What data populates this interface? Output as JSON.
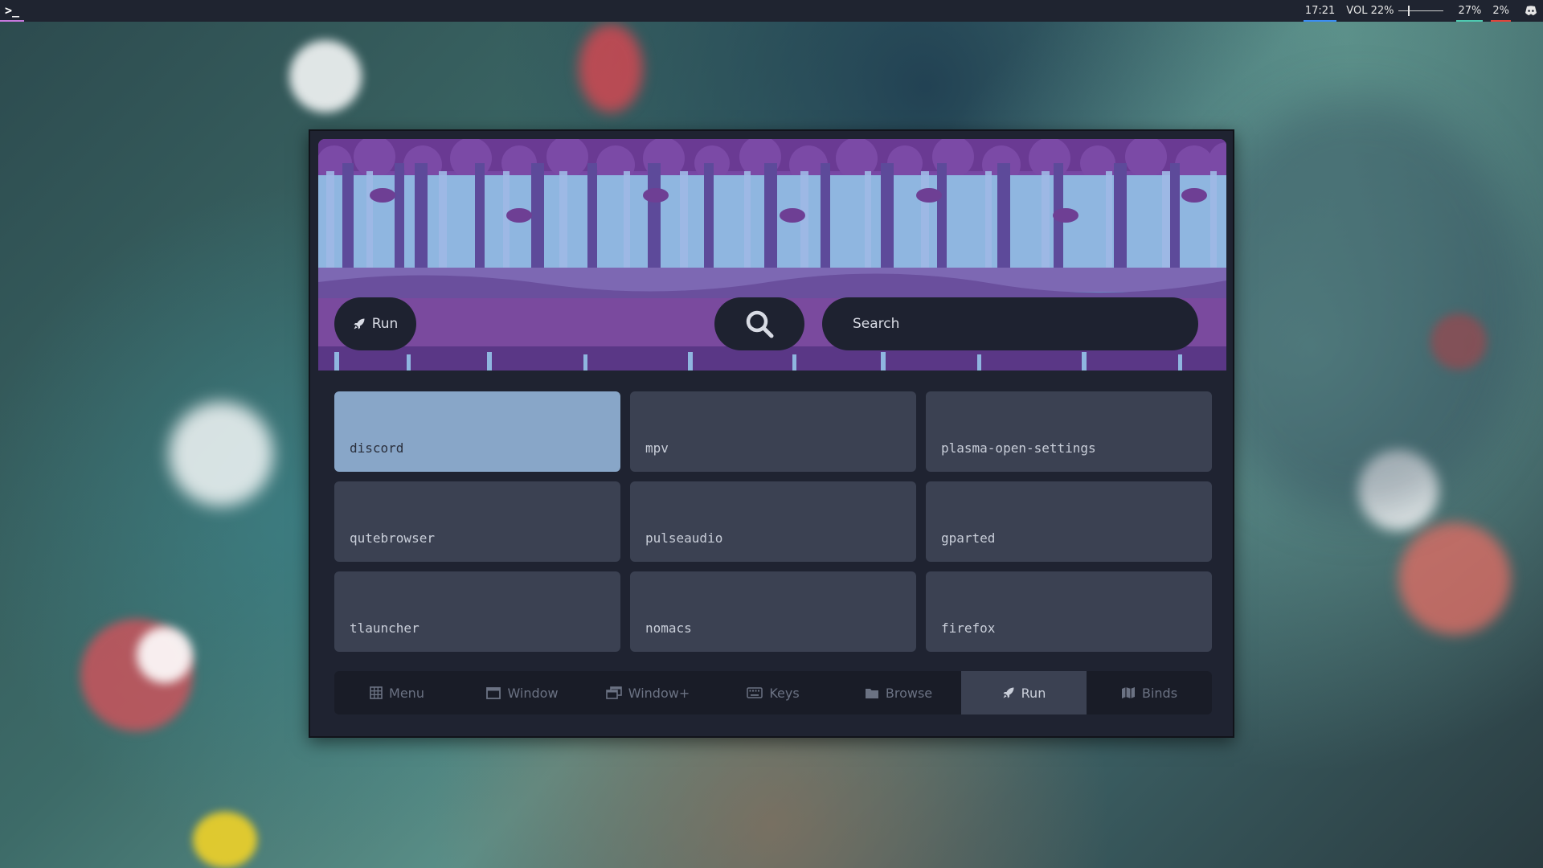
{
  "topbar": {
    "time": "17:21",
    "volume": "VOL 22%",
    "volume_level": 0.22,
    "cpu": "27%",
    "mem": "2%",
    "colors": {
      "time_underline": "#3b8df2",
      "cpu_underline": "#4ec9b0",
      "mem_underline": "#e0443b"
    }
  },
  "launcher": {
    "mode_label": "Run",
    "search_placeholder": "Search",
    "apps": [
      {
        "label": "discord",
        "selected": true
      },
      {
        "label": "mpv"
      },
      {
        "label": "plasma-open-settings"
      },
      {
        "label": "qutebrowser"
      },
      {
        "label": "pulseaudio"
      },
      {
        "label": "gparted"
      },
      {
        "label": "tlauncher"
      },
      {
        "label": "nomacs"
      },
      {
        "label": "firefox"
      }
    ],
    "tabs": [
      {
        "label": "Menu",
        "icon": "grid-icon"
      },
      {
        "label": "Window",
        "icon": "window-icon"
      },
      {
        "label": "Window+",
        "icon": "windows-icon"
      },
      {
        "label": "Keys",
        "icon": "keyboard-icon"
      },
      {
        "label": "Browse",
        "icon": "folder-icon"
      },
      {
        "label": "Run",
        "icon": "rocket-icon",
        "active": true
      },
      {
        "label": "Binds",
        "icon": "map-icon"
      }
    ],
    "colors": {
      "selected_tile": "#88a6c8",
      "tile": "#3b4152",
      "panel": "#1f2331"
    }
  }
}
